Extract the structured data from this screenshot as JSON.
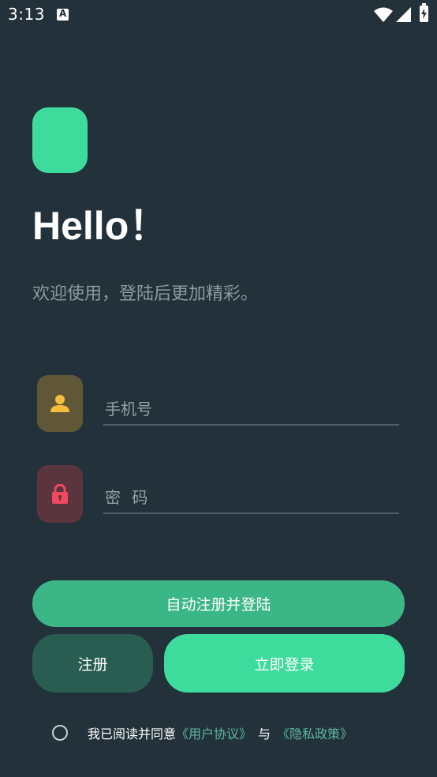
{
  "status": {
    "time": "3:13"
  },
  "brand": {
    "title": "Hello！",
    "subtitle": "欢迎使用，登陆后更加精彩。",
    "logo_color": "#3edc9c"
  },
  "form": {
    "phone_placeholder": "手机号",
    "password_placeholder": "密 码"
  },
  "buttons": {
    "auto_register": "自动注册并登陆",
    "register": "注册",
    "login": "立即登录"
  },
  "agreement": {
    "prefix": "我已阅读并同意",
    "user_agreement": "《用户协议》",
    "and": "与",
    "privacy_policy": "《隐私政策》"
  },
  "icons": {
    "phone_field": "user-icon",
    "password_field": "lock-icon"
  },
  "colors": {
    "background": "#22313a",
    "accent": "#3edc9c",
    "auto_button": "#3bb787",
    "register_button": "#295d52",
    "link": "#5fb6a5"
  }
}
